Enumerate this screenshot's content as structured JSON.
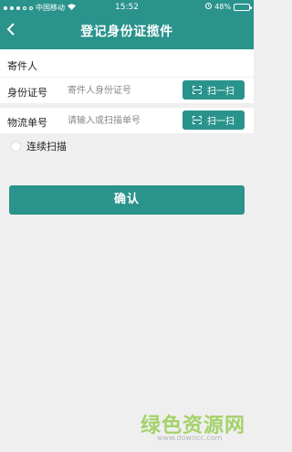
{
  "statusbar": {
    "carrier": "中国移动",
    "wifi_icon": "wifi-icon",
    "time": "15:52",
    "battery": "48%",
    "battery_level": 0.48
  },
  "header": {
    "back_icon": "back-chevron-icon",
    "title": "登记身份证揽件"
  },
  "sender": {
    "section_title": "寄件人",
    "id_label": "身份证号",
    "id_placeholder": "寄件人身份证号",
    "id_scan": "扫一扫"
  },
  "logistics": {
    "label": "物流单号",
    "placeholder": "请输入或扫描单号",
    "scan": "扫一扫"
  },
  "continuous_scan": {
    "label": "连续扫描"
  },
  "confirm_button": "确认",
  "watermark": {
    "main": "绿色资源网",
    "url": "www.downcc.com"
  },
  "colors": {
    "primary": "#2a938c",
    "background": "#efefef",
    "watermark_green": "#a4d26a"
  }
}
